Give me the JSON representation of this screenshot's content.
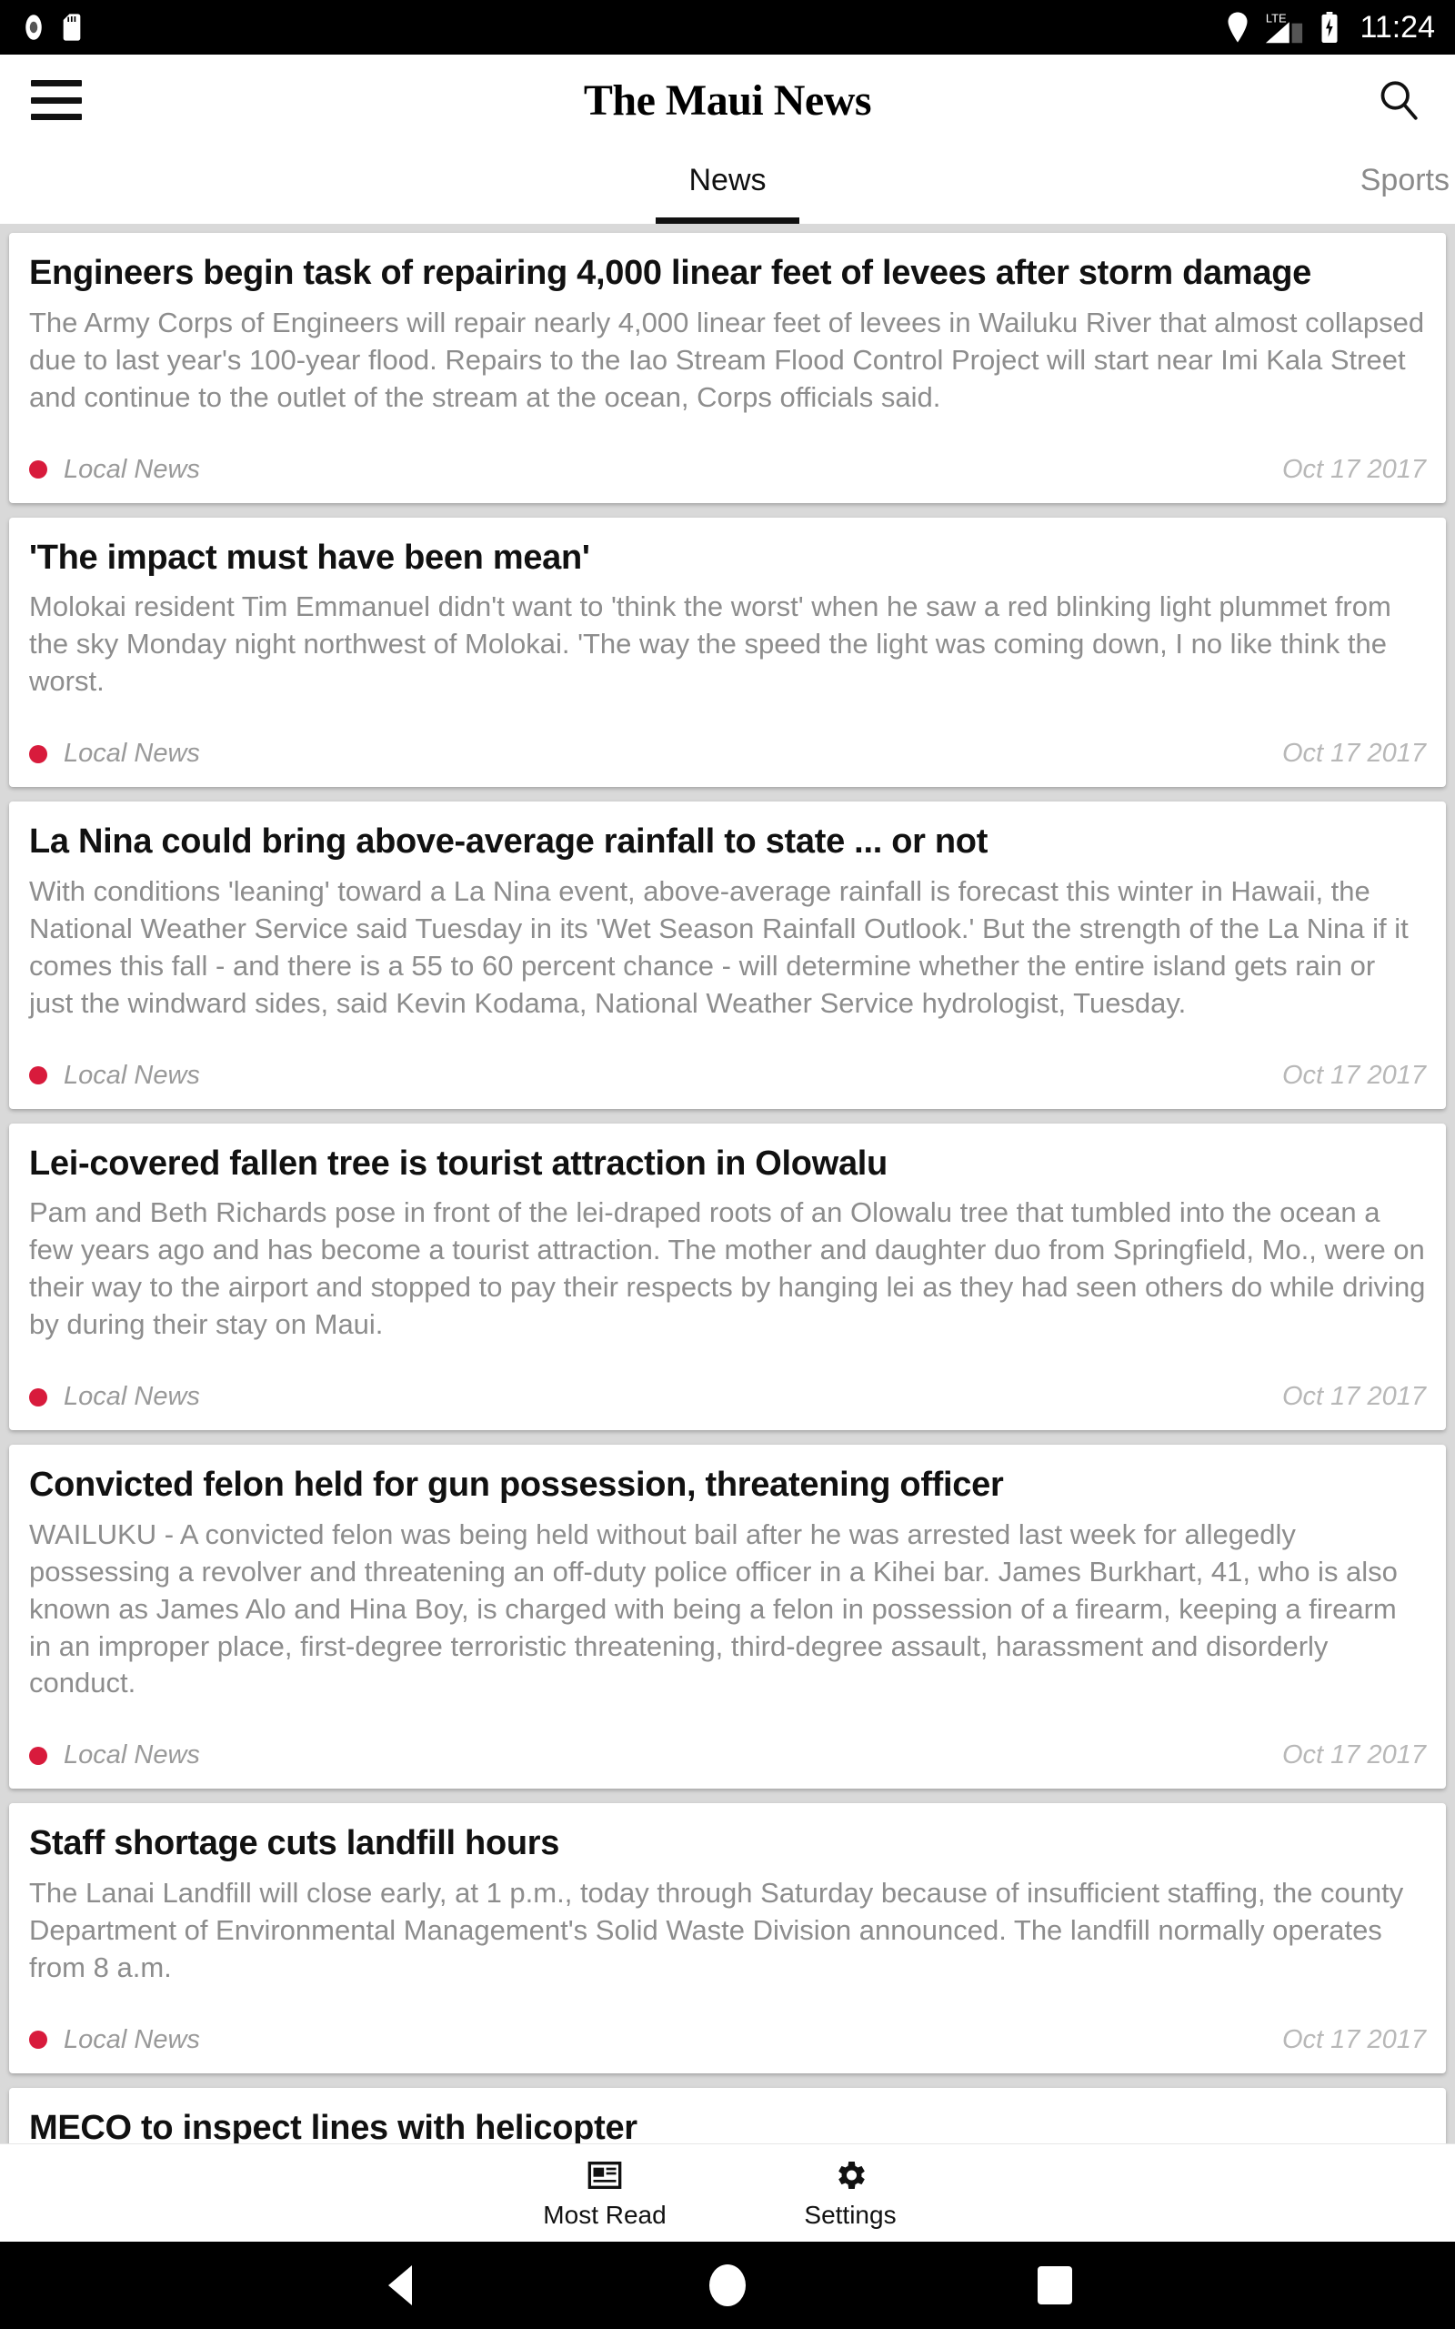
{
  "status_bar": {
    "icons_left": [
      "record-icon",
      "sd-card-icon"
    ],
    "icons_right": [
      "location-pin-icon",
      "lte-signal-icon",
      "battery-charging-icon"
    ],
    "network_label": "LTE",
    "time": "11:24"
  },
  "app_bar": {
    "menu_icon": "hamburger-menu-icon",
    "title": "The Maui News",
    "search_icon": "search-icon"
  },
  "tabs": [
    {
      "label": "News",
      "active": true
    },
    {
      "label": "Sports",
      "active": false
    }
  ],
  "articles": [
    {
      "headline": "Engineers begin task of repairing 4,000 linear feet of levees after storm damage",
      "summary": "The Army Corps of Engineers will repair nearly 4,000 linear feet of levees in Wailuku River that almost collapsed due to last year's 100-year flood. Repairs to the Iao Stream Flood Control Project will start near Imi Kala Street and continue to the outlet of the stream at the ocean, Corps officials said.",
      "category": "Local News",
      "date": "Oct 17 2017"
    },
    {
      "headline": "'The impact must have been mean'",
      "summary": "Molokai resident Tim Emmanuel didn't want to 'think the worst' when he saw a red blinking light plummet from the sky Monday night northwest of Molokai. 'The way the speed the light was coming down, I no like think the worst.",
      "category": "Local News",
      "date": "Oct 17 2017"
    },
    {
      "headline": "La Nina could bring above-average rainfall to state ... or not",
      "summary": "With conditions 'leaning' toward a La Nina event, above-average rainfall is forecast this winter in Hawaii, the National Weather Service said Tuesday in its 'Wet Season Rainfall Outlook.' But the strength of the La Nina if it comes this fall - and there is a 55 to 60 percent chance - will determine whether the entire island gets rain or just the windward sides, said Kevin Kodama, National Weather Service hydrologist, Tuesday.",
      "category": "Local News",
      "date": "Oct 17 2017"
    },
    {
      "headline": "Lei-covered fallen tree is tourist attraction in Olowalu",
      "summary": "Pam and Beth Richards pose in front of the lei-draped roots of an Olowalu tree that tumbled into the ocean a few years ago and has become a tourist attraction. The mother and daughter duo from Springfield, Mo., were on their way to the airport and stopped to pay their respects by hanging lei as they had seen others do while driving by during their stay on Maui.",
      "category": "Local News",
      "date": "Oct 17 2017"
    },
    {
      "headline": "Convicted felon held for gun possession, threatening officer",
      "summary": "WAILUKU - A convicted felon was being held without bail after he was arrested last week for allegedly possessing a revolver and threatening an off-duty police officer in a Kihei bar. James Burkhart, 41, who is also known as James Alo and Hina Boy, is charged with being a felon in possession of a firearm, keeping a firearm in an improper place, first-degree terroristic threatening, third-degree assault, harassment and disorderly conduct.",
      "category": "Local News",
      "date": "Oct 17 2017"
    },
    {
      "headline": "Staff shortage cuts landfill hours",
      "summary": "The Lanai Landfill will close early, at 1 p.m., today through Saturday because of insufficient staffing, the county Department of Environmental Management's Solid Waste Division announced. The landfill normally operates from 8 a.m.",
      "category": "Local News",
      "date": "Oct 17 2017"
    },
    {
      "headline": "MECO to inspect lines with helicopter",
      "summary": "",
      "category": "",
      "date": ""
    }
  ],
  "bottom_nav": [
    {
      "label": "Most Read",
      "icon": "newspaper-icon"
    },
    {
      "label": "Settings",
      "icon": "gear-icon"
    }
  ],
  "android_nav": {
    "back": "back-triangle-icon",
    "home": "home-circle-icon",
    "recents": "recents-square-icon"
  },
  "colors": {
    "accent_dot": "#d81b3c",
    "page_background": "#d9d9d9",
    "card_background": "#ffffff",
    "headline": "#111111",
    "summary": "#8d8d8d"
  }
}
